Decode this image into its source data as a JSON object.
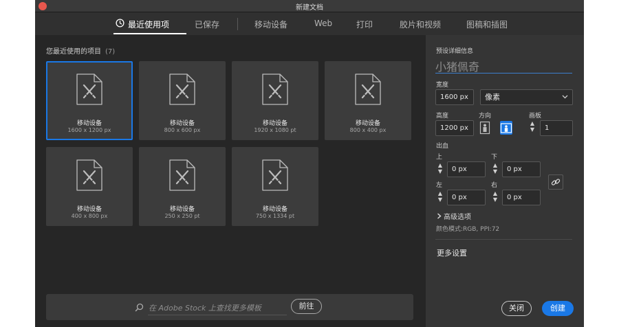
{
  "window": {
    "title": "新建文档"
  },
  "tabs": [
    {
      "label": "最近使用项"
    },
    {
      "label": "已保存"
    },
    {
      "label": "移动设备"
    },
    {
      "label": "Web"
    },
    {
      "label": "打印"
    },
    {
      "label": "胶片和视频"
    },
    {
      "label": "图稿和插图"
    }
  ],
  "recent": {
    "heading": "您最近使用的项目",
    "count": "(7)",
    "items": [
      {
        "name": "移动设备",
        "size": "1600 x 1200 px"
      },
      {
        "name": "移动设备",
        "size": "800 x 600 px"
      },
      {
        "name": "移动设备",
        "size": "1920 x 1080 pt"
      },
      {
        "name": "移动设备",
        "size": "800 x 400 px"
      },
      {
        "name": "移动设备",
        "size": "400 x 800 px"
      },
      {
        "name": "移动设备",
        "size": "250 x 250 pt"
      },
      {
        "name": "移动设备",
        "size": "750 x 1334 pt"
      }
    ]
  },
  "stock": {
    "placeholder": "在 Adobe Stock 上查找更多模板",
    "go_label": "前往"
  },
  "preset": {
    "section_label": "预设详细信息",
    "name": "小猪佩奇",
    "width_label": "宽度",
    "width_value": "1600 px",
    "unit_value": "像素",
    "height_label": "高度",
    "height_value": "1200 px",
    "orientation_label": "方向",
    "artboards_label": "画板",
    "artboards_value": "1",
    "bleed_label": "出血",
    "bleed_top_label": "上",
    "bleed_top_value": "0 px",
    "bleed_bottom_label": "下",
    "bleed_bottom_value": "0 px",
    "bleed_left_label": "左",
    "bleed_left_value": "0 px",
    "bleed_right_label": "右",
    "bleed_right_value": "0 px",
    "advanced_label": "高级选项",
    "color_mode": "颜色模式:RGB, PPI:72",
    "more_settings": "更多设置"
  },
  "actions": {
    "close_label": "关闭",
    "create_label": "创建"
  },
  "colors": {
    "accent": "#1a78e6",
    "window_bg": "#262626",
    "panel_bg": "#353535",
    "card_bg": "#3c3c3c"
  }
}
